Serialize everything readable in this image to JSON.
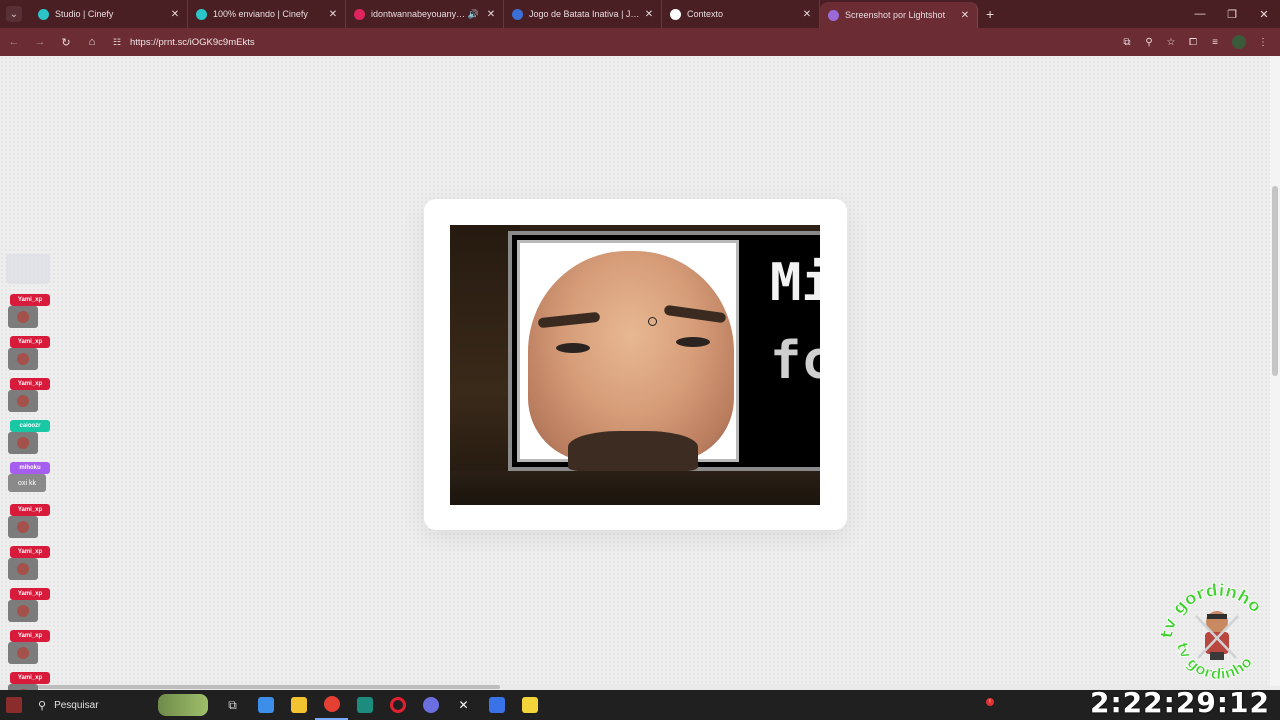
{
  "browser": {
    "tabs": [
      {
        "title": "Studio | Cinefy",
        "favicon_color": "#2bc4c9",
        "active": false,
        "audio": false
      },
      {
        "title": "100% enviando | Cinefy",
        "favicon_color": "#2bc4c9",
        "active": false,
        "audio": false
      },
      {
        "title": "idontwannabeyouanymore",
        "favicon_color": "#e0245e",
        "active": false,
        "audio": true
      },
      {
        "title": "Jogo de Batata Inativa | Jogue",
        "favicon_color": "#3b6fd6",
        "active": false,
        "audio": false
      },
      {
        "title": "Contexto",
        "favicon_color": "#ffffff",
        "active": false,
        "audio": false
      },
      {
        "title": "Screenshot por Lightshot",
        "favicon_color": "#9c6ad6",
        "active": true,
        "audio": false
      }
    ],
    "address": "https://prnt.sc/iOGK9c9mEkts",
    "theme_color": "#6b2c34",
    "tabstrip_color": "#4a1f24"
  },
  "screenshot": {
    "text_line1": "Mi",
    "text_line2": "fc"
  },
  "chat": {
    "messages": [
      {
        "user": "Yami_xp",
        "color": "#d81b3a",
        "kind": "avatar"
      },
      {
        "user": "Yami_xp",
        "color": "#d81b3a",
        "kind": "avatar"
      },
      {
        "user": "Yami_xp",
        "color": "#d81b3a",
        "kind": "avatar"
      },
      {
        "user": "caioozr",
        "color": "#19c7a4",
        "kind": "avatar"
      },
      {
        "user": "mihoku",
        "color": "#a55ef0",
        "kind": "text",
        "text": "oxi kk"
      },
      {
        "user": "Yami_xp",
        "color": "#d81b3a",
        "kind": "avatar"
      },
      {
        "user": "Yami_xp",
        "color": "#d81b3a",
        "kind": "avatar"
      },
      {
        "user": "Yami_xp",
        "color": "#d81b3a",
        "kind": "avatar"
      },
      {
        "user": "Yami_xp",
        "color": "#d81b3a",
        "kind": "avatar"
      },
      {
        "user": "Yami_xp",
        "color": "#d81b3a",
        "kind": "avatar"
      }
    ]
  },
  "logo": {
    "text": "tv gordinho tv gordinho",
    "color": "#3fd12b"
  },
  "taskbar": {
    "search_label": "Pesquisar",
    "clock": "2:22:29:12"
  }
}
